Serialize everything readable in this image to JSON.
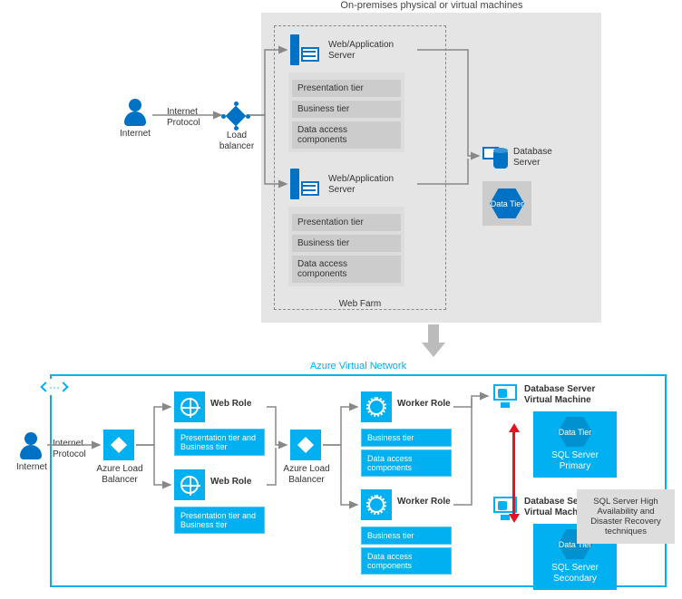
{
  "top": {
    "title": "On-premises physical or virtual machines",
    "internet": "Internet",
    "internet_protocol": "Internet Protocol",
    "load_balancer": "Load balancer",
    "web_farm": "Web Farm",
    "servers": [
      {
        "name": "Web/Application Server",
        "tiers": {
          "outer": "Presentation tier",
          "mid": "Business tier",
          "inner": "Data access components"
        }
      },
      {
        "name": "Web/Application Server",
        "tiers": {
          "outer": "Presentation tier",
          "mid": "Business tier",
          "inner": "Data access components"
        }
      }
    ],
    "db_server": "Database Server",
    "data_tier": "Data Tier"
  },
  "bottom": {
    "vnet_title": "Azure Virtual Network",
    "internet": "Internet",
    "internet_protocol": "Internet Protocol",
    "alb1": "Azure Load Balancer",
    "alb2": "Azure Load Balancer",
    "web_roles": [
      {
        "name": "Web Role",
        "tier": "Presentation tier and Business tier"
      },
      {
        "name": "Web Role",
        "tier": "Presentation tier and Business tier"
      }
    ],
    "worker_roles": [
      {
        "name": "Worker Role",
        "tiers": {
          "a": "Business tier",
          "b": "Data access components"
        }
      },
      {
        "name": "Worker Role",
        "tiers": {
          "a": "Business tier",
          "b": "Data access components"
        }
      }
    ],
    "db_vms": [
      {
        "name": "Database Server Virtual Machine",
        "data_tier": "Data Tier",
        "sql": "SQL Server Primary"
      },
      {
        "name": "Database Server Virtual Machine",
        "data_tier": "Data Tier",
        "sql": "SQL Server Secondary"
      }
    ],
    "hadr": "SQL Server High Availability and Disaster Recovery techniques"
  }
}
